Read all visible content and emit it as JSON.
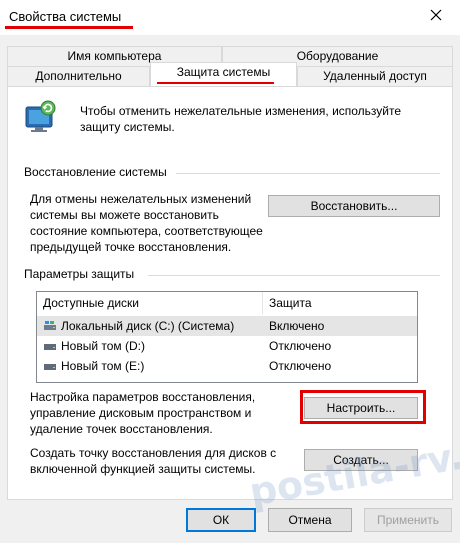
{
  "window": {
    "title": "Свойства системы",
    "close_icon": "close-icon"
  },
  "tabs": [
    {
      "label": "Имя компьютера",
      "row": 1
    },
    {
      "label": "Оборудование",
      "row": 1
    },
    {
      "label": "Дополнительно",
      "row": 2
    },
    {
      "label": "Защита системы",
      "row": 2,
      "active": true
    },
    {
      "label": "Удаленный доступ",
      "row": 2
    }
  ],
  "intro": {
    "icon": "system-protection-icon",
    "text": "Чтобы отменить нежелательные изменения, используйте защиту системы."
  },
  "restore": {
    "section_title": "Восстановление системы",
    "text": "Для отмены нежелательных изменений системы вы можете восстановить состояние компьютера, соответствующее предыдущей точке восстановления.",
    "button": "Восстановить..."
  },
  "protection": {
    "section_title": "Параметры защиты",
    "columns": [
      "Доступные диски",
      "Защита"
    ],
    "drives": [
      {
        "name": "Локальный диск (C:) (Система)",
        "status": "Включено",
        "icon": "system-drive-icon",
        "selected": true
      },
      {
        "name": "Новый том (D:)",
        "status": "Отключено",
        "icon": "drive-icon",
        "selected": false
      },
      {
        "name": "Новый том (E:)",
        "status": "Отключено",
        "icon": "drive-icon",
        "selected": false
      }
    ],
    "configure_text": "Настройка параметров восстановления, управление дисковым пространством и удаление точек восстановления.",
    "configure_button": "Настроить...",
    "create_text": "Создать точку восстановления для дисков с включенной функцией защиты системы.",
    "create_button": "Создать..."
  },
  "footer": {
    "ok": "ОК",
    "cancel": "Отмена",
    "apply": "Применить"
  },
  "watermark": "postila-rv.ru",
  "colors": {
    "highlight_red": "#e00000",
    "dialog_bg": "#f0f0f0",
    "button_bg": "#e1e1e1",
    "selected_row": "#e5e5e5"
  }
}
